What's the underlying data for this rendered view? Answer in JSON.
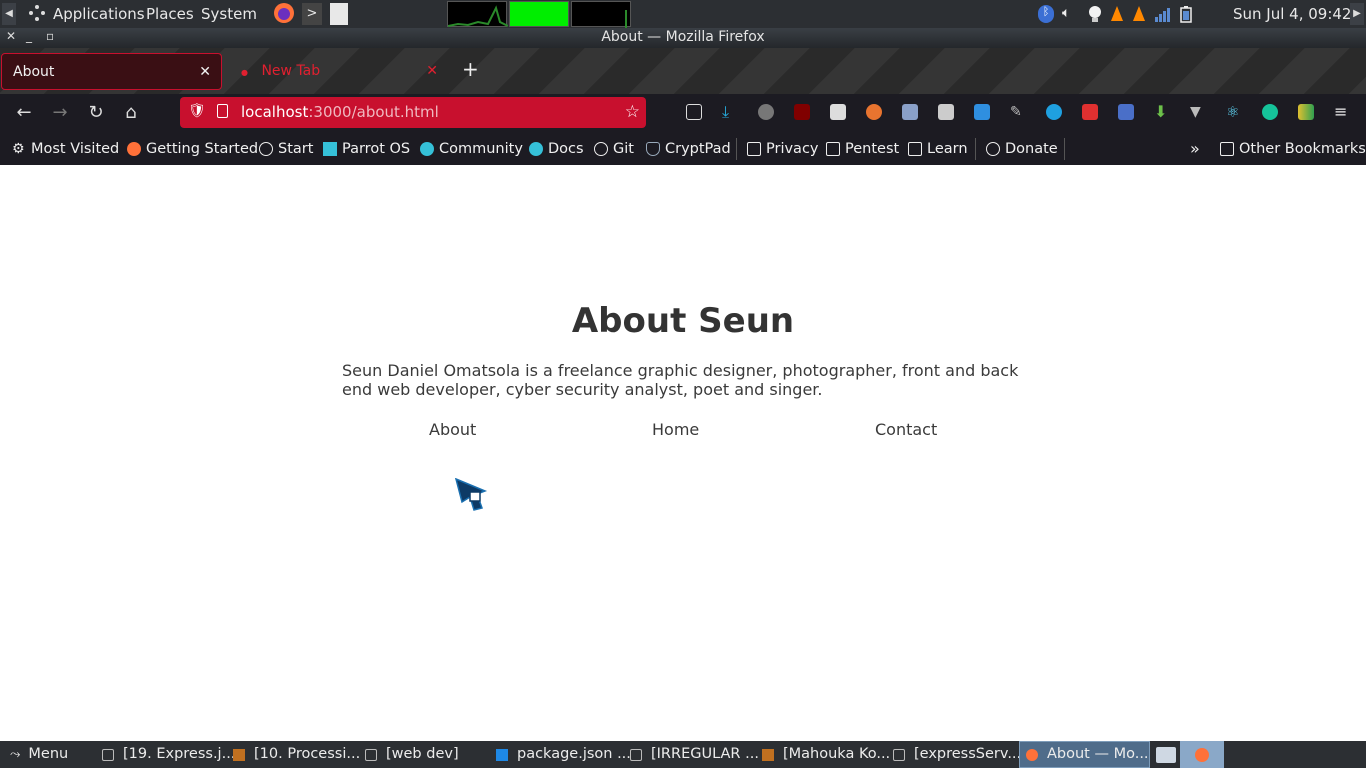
{
  "system_panel": {
    "menus": [
      "Applications",
      "Places",
      "System"
    ],
    "clock": "Sun Jul 4, 09:42"
  },
  "window": {
    "title": "About — Mozilla Firefox"
  },
  "tabs": [
    {
      "label": "About",
      "active": true
    },
    {
      "label": "New Tab",
      "active": false
    }
  ],
  "url_bar": {
    "host": "localhost",
    "path": ":3000/about.html"
  },
  "bookmarks": [
    "Most Visited",
    "Getting Started",
    "Start",
    "Parrot OS",
    "Community",
    "Docs",
    "Git",
    "CryptPad",
    "Privacy",
    "Pentest",
    "Learn",
    "Donate"
  ],
  "other_bookmarks": "Other Bookmarks",
  "page": {
    "heading": "About Seun",
    "paragraph": "Seun Daniel Omatsola is a freelance graphic designer, photographer, front and back end web developer, cyber security analyst, poet and singer.",
    "links": [
      "About",
      "Home",
      "Contact"
    ]
  },
  "taskbar": {
    "menu_label": "Menu",
    "tasks": [
      "[19. Express.j...",
      "[10. Processi...",
      "[web dev]",
      "package.json ...",
      "[IRREGULAR ...",
      "[Mahouka Ko...",
      "[expressServ...",
      "About — Mo..."
    ]
  },
  "colors": {
    "accent_red": "#c8102e",
    "panel_bg": "#2c2f33",
    "toolbar_bg": "#1c1b22"
  }
}
